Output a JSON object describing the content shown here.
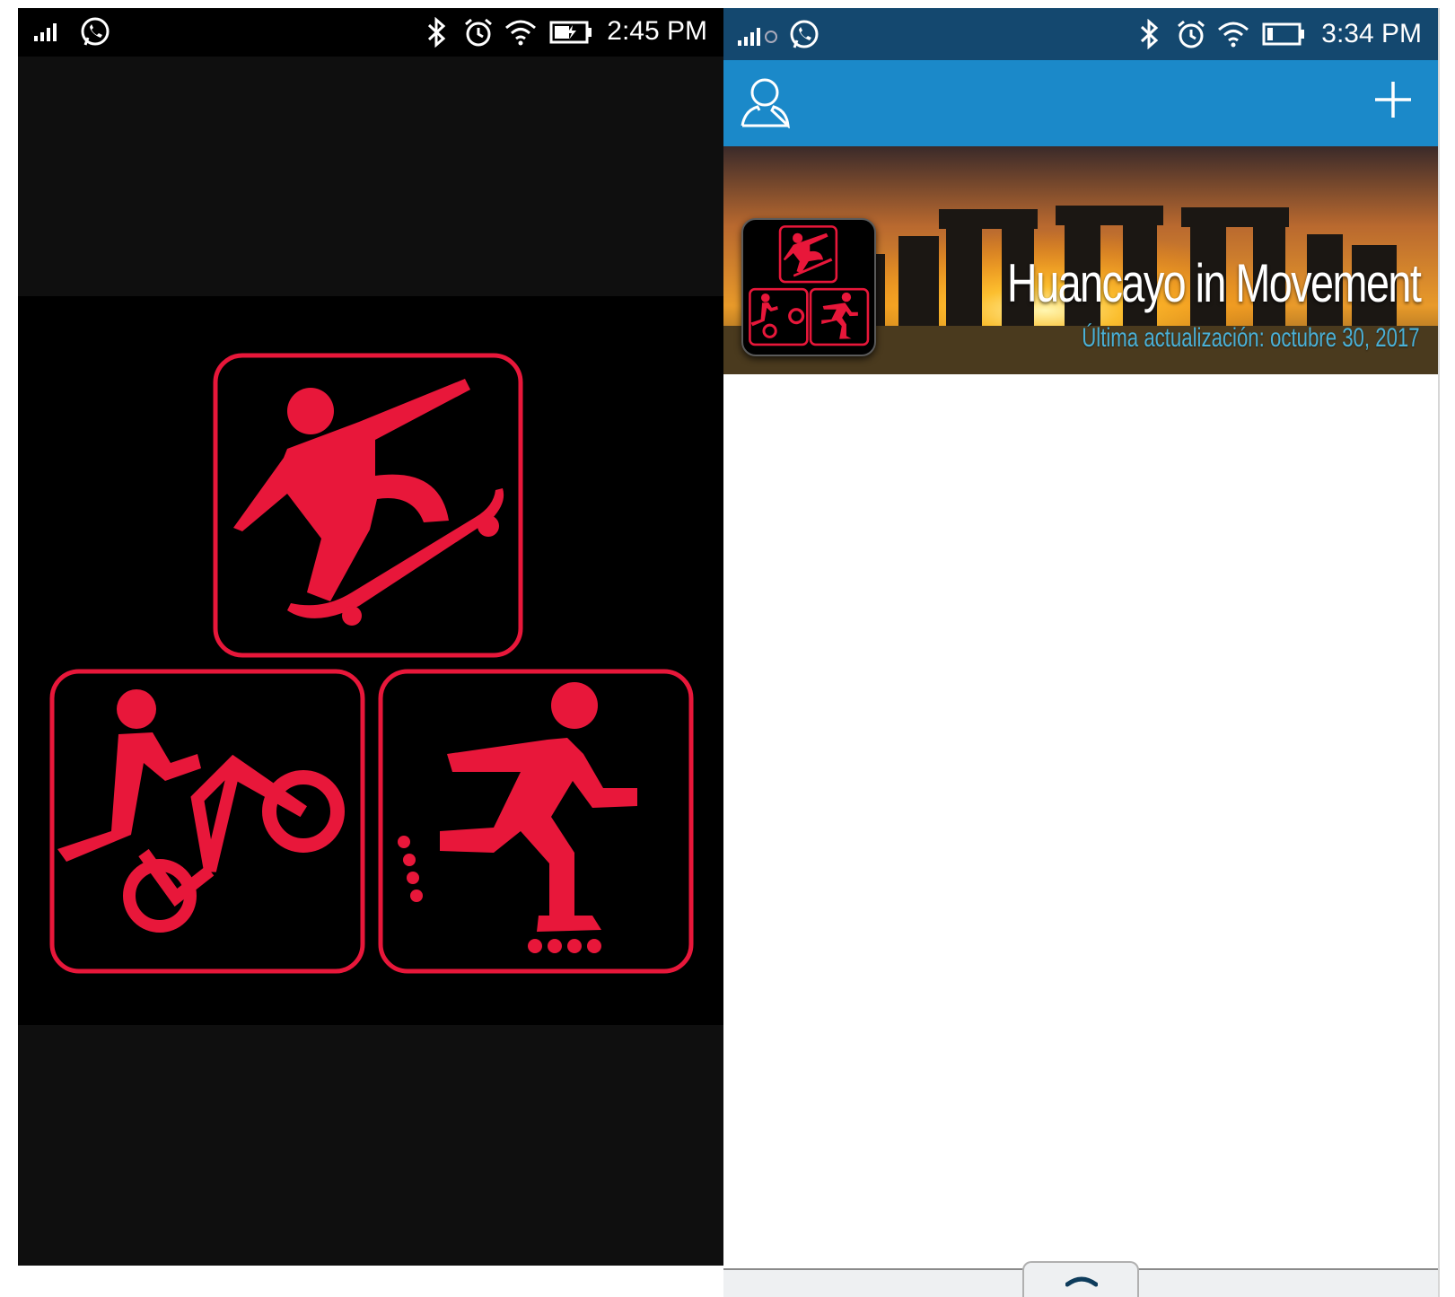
{
  "colors": {
    "logo_red": "#e8173a",
    "appbar_blue": "#1b89c9",
    "statusbar_blue": "#14486f",
    "subtitle_teal": "#4ab0d6"
  },
  "left_screen": {
    "status_bar": {
      "time": "2:45 PM",
      "icons": [
        "signal-icon",
        "whatsapp-icon",
        "bluetooth-icon",
        "alarm-icon",
        "wifi-icon",
        "battery-charging-icon"
      ]
    },
    "splash_logo": {
      "icons": [
        "skateboarder-icon",
        "bmx-rider-icon",
        "inline-skater-icon"
      ]
    }
  },
  "right_screen": {
    "status_bar": {
      "time": "3:34 PM",
      "icons": [
        "signal-icon",
        "whatsapp-icon",
        "bluetooth-icon",
        "alarm-icon",
        "wifi-icon",
        "battery-icon"
      ]
    },
    "app_bar": {
      "icons": [
        "profile-icon",
        "add-icon"
      ]
    },
    "banner": {
      "title": "Huancayo in Movement",
      "subtitle": "Última actualización: octubre 30, 2017",
      "background": "stonehenge-sunset-image"
    },
    "bottom_tray": {
      "icons": [
        "chevron-up-icon"
      ]
    }
  }
}
